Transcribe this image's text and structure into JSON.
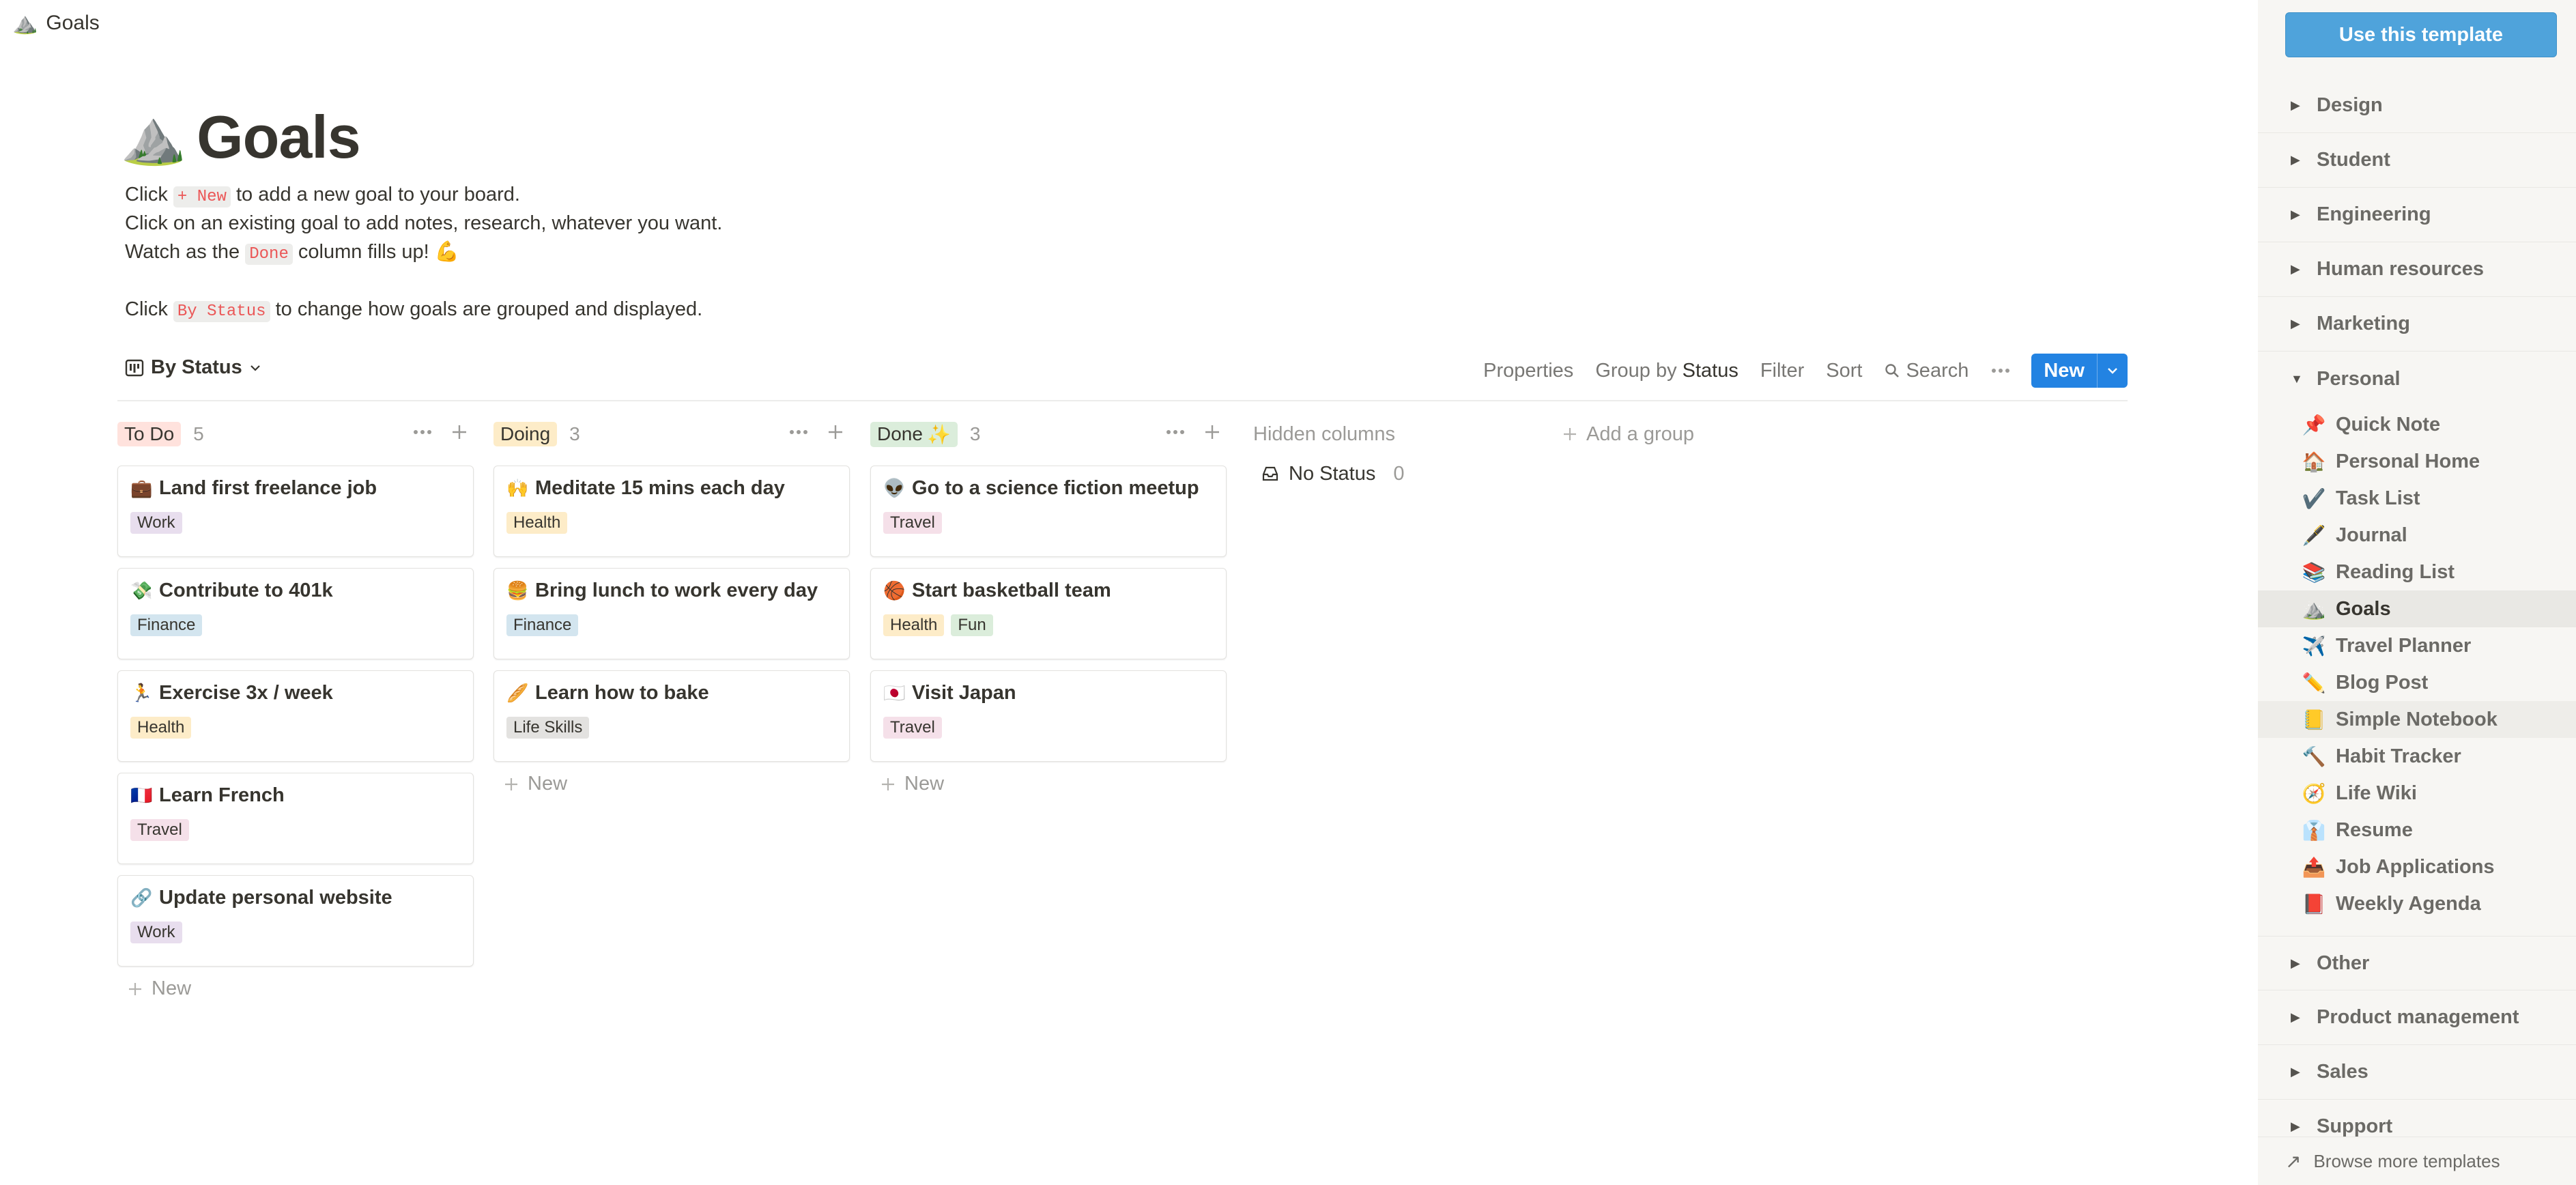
{
  "topbar": {
    "emoji": "⛰️",
    "title": "Goals"
  },
  "page": {
    "emoji": "⛰️",
    "title": "Goals",
    "lines": [
      {
        "pre": "Click ",
        "code": "+ New",
        "post": " to add a new goal to your board."
      },
      {
        "pre": "Click on an existing goal to add notes, research, whatever you want.",
        "code": "",
        "post": ""
      },
      {
        "pre": "Watch as the ",
        "code": "Done",
        "post": " column fills up! 💪"
      },
      {
        "pre": "Click ",
        "code": "By Status",
        "post": " to change how goals are grouped and displayed."
      }
    ]
  },
  "view": {
    "label": "By Status"
  },
  "toolbar": {
    "properties": "Properties",
    "group_by": "Group by",
    "group_by_value": "Status",
    "filter": "Filter",
    "sort": "Sort",
    "search": "Search",
    "new": "New"
  },
  "colors": {
    "todo_bg": "#ffe2dd",
    "doing_bg": "#fdecc8",
    "done_bg": "#dbeddb",
    "accent": "#2383e2",
    "template_btn": "#4fa3db"
  },
  "board": {
    "add_new": "New",
    "columns": [
      {
        "name": "To Do",
        "count": "5",
        "pill_color": "#ffe2dd",
        "cards": [
          {
            "emoji": "💼",
            "title": "Land first freelance job",
            "tags": [
              {
                "label": "Work",
                "color": "#e8deee"
              }
            ]
          },
          {
            "emoji": "💸",
            "title": "Contribute to 401k",
            "tags": [
              {
                "label": "Finance",
                "color": "#d3e5ef"
              }
            ]
          },
          {
            "emoji": "🏃",
            "title": "Exercise 3x / week",
            "tags": [
              {
                "label": "Health",
                "color": "#fdecc8"
              }
            ]
          },
          {
            "emoji": "🇫🇷",
            "title": "Learn French",
            "tags": [
              {
                "label": "Travel",
                "color": "#f5e0e9"
              }
            ]
          },
          {
            "emoji": "🔗",
            "title": "Update personal website",
            "tags": [
              {
                "label": "Work",
                "color": "#e8deee"
              }
            ]
          }
        ]
      },
      {
        "name": "Doing",
        "count": "3",
        "pill_color": "#fdecc8",
        "cards": [
          {
            "emoji": "🙌",
            "title": "Meditate 15 mins each day",
            "tags": [
              {
                "label": "Health",
                "color": "#fdecc8"
              }
            ]
          },
          {
            "emoji": "🍔",
            "title": "Bring lunch to work every day",
            "tags": [
              {
                "label": "Finance",
                "color": "#d3e5ef"
              }
            ]
          },
          {
            "emoji": "🥖",
            "title": "Learn how to bake",
            "tags": [
              {
                "label": "Life Skills",
                "color": "#e3e2e0"
              }
            ]
          }
        ]
      },
      {
        "name": "Done",
        "suffix": "✨",
        "count": "3",
        "pill_color": "#dbeddb",
        "cards": [
          {
            "emoji": "👽",
            "title": "Go to a science fiction meetup",
            "tags": [
              {
                "label": "Travel",
                "color": "#f5e0e9"
              }
            ]
          },
          {
            "emoji": "🏀",
            "title": "Start basketball team",
            "tags": [
              {
                "label": "Health",
                "color": "#fdecc8"
              },
              {
                "label": "Fun",
                "color": "#dbeddb"
              }
            ]
          },
          {
            "emoji": "🇯🇵",
            "title": "Visit Japan",
            "tags": [
              {
                "label": "Travel",
                "color": "#f5e0e9"
              }
            ]
          }
        ]
      }
    ],
    "hidden": {
      "title": "Hidden columns",
      "items": [
        {
          "emoji": "📥",
          "label": "No Status",
          "count": "0"
        }
      ]
    },
    "add_group": "Add a group"
  },
  "sidebar": {
    "use_template": "Use this template",
    "categories_top": [
      "Design",
      "Student",
      "Engineering",
      "Human resources",
      "Marketing"
    ],
    "personal": {
      "label": "Personal",
      "items": [
        {
          "emoji": "📌",
          "label": "Quick Note"
        },
        {
          "emoji": "🏠",
          "label": "Personal Home"
        },
        {
          "emoji": "✔️",
          "label": "Task List"
        },
        {
          "emoji": "🖋️",
          "label": "Journal"
        },
        {
          "emoji": "📚",
          "label": "Reading List"
        },
        {
          "emoji": "⛰️",
          "label": "Goals"
        },
        {
          "emoji": "✈️",
          "label": "Travel Planner"
        },
        {
          "emoji": "✏️",
          "label": "Blog Post"
        },
        {
          "emoji": "📒",
          "label": "Simple Notebook"
        },
        {
          "emoji": "🔨",
          "label": "Habit Tracker"
        },
        {
          "emoji": "🧭",
          "label": "Life Wiki"
        },
        {
          "emoji": "👔",
          "label": "Resume"
        },
        {
          "emoji": "📤",
          "label": "Job Applications"
        },
        {
          "emoji": "📕",
          "label": "Weekly Agenda"
        }
      ]
    },
    "categories_bottom": [
      "Other",
      "Product management",
      "Sales",
      "Support"
    ],
    "browse": "Browse more templates"
  }
}
